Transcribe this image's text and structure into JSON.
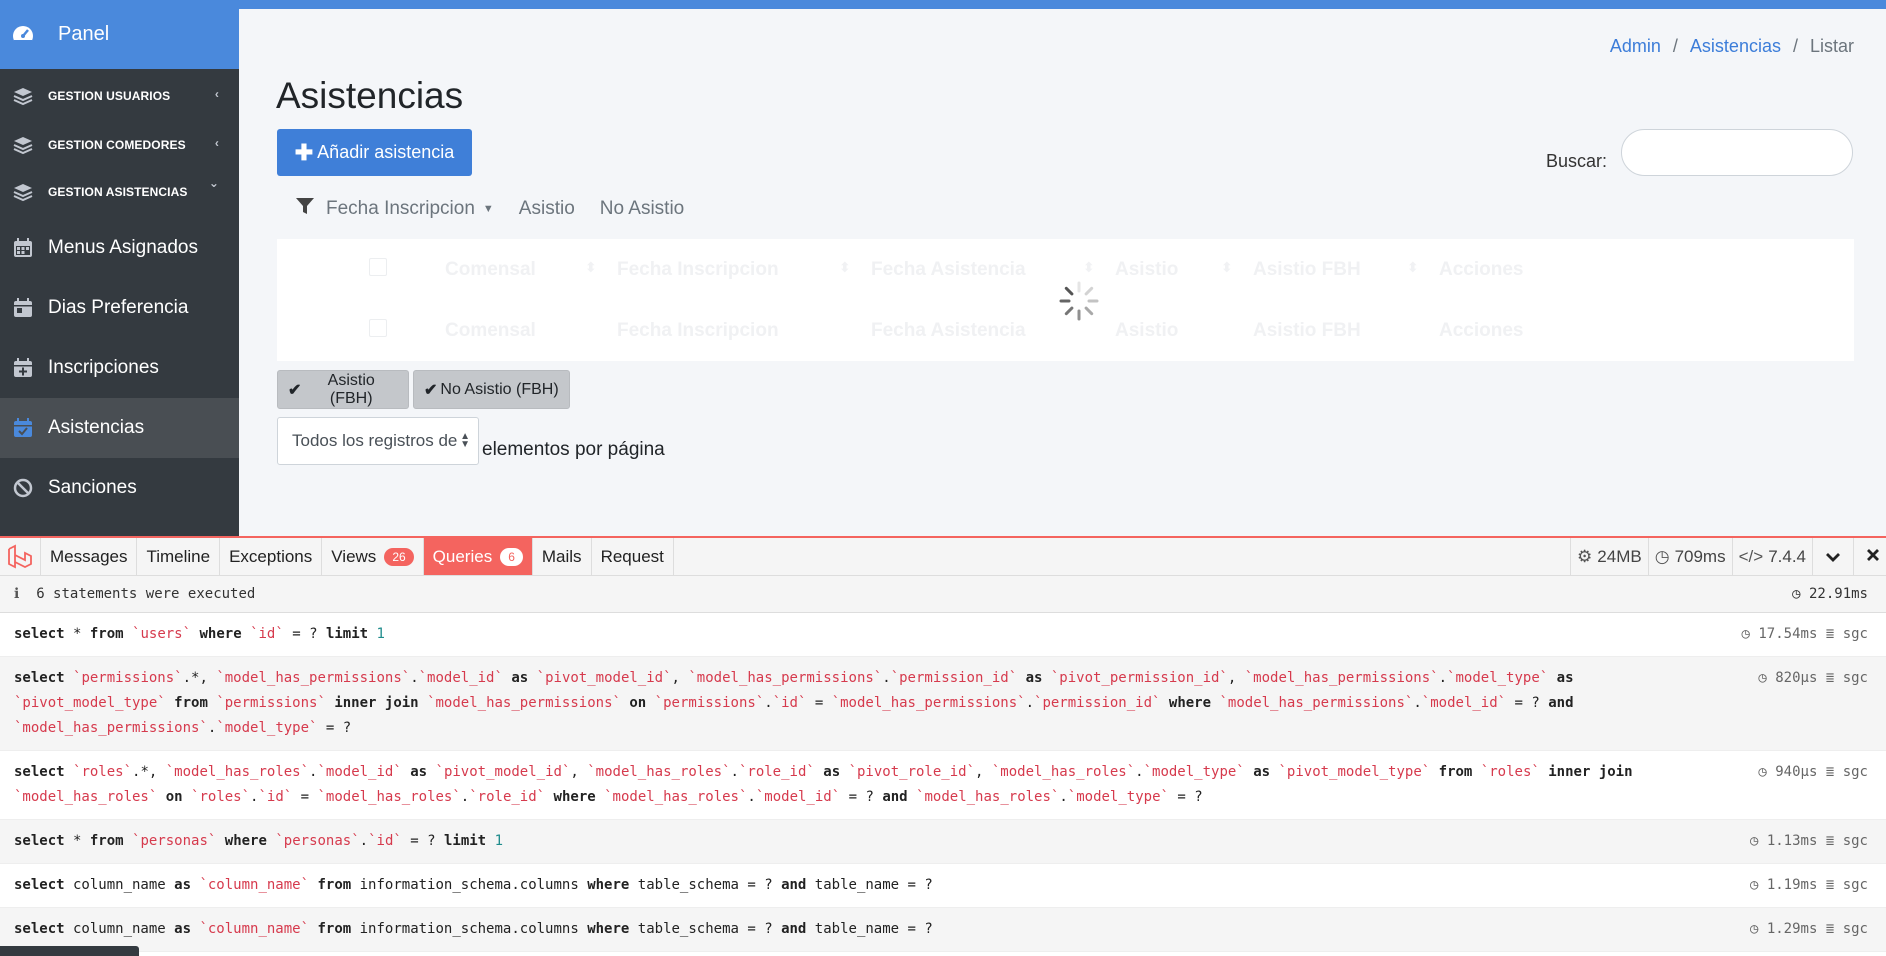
{
  "sidebar": {
    "brand": "Panel",
    "groups": [
      {
        "label": "GESTION USUARIOS",
        "chevron": "‹"
      },
      {
        "label": "GESTION COMEDORES",
        "chevron": "‹"
      },
      {
        "label": "GESTION ASISTENCIAS",
        "chevron": "⌄"
      }
    ],
    "links": [
      {
        "label": "Menus Asignados",
        "icon": "calendar-icon"
      },
      {
        "label": "Dias Preferencia",
        "icon": "calendar-day-icon"
      },
      {
        "label": "Inscripciones",
        "icon": "calendar-plus-icon"
      },
      {
        "label": "Asistencias",
        "icon": "calendar-check-icon",
        "active": true
      },
      {
        "label": "Sanciones",
        "icon": "ban-icon"
      }
    ]
  },
  "breadcrumb": {
    "admin": "Admin",
    "sep": "/",
    "section": "Asistencias",
    "current": "Listar"
  },
  "page": {
    "title": "Asistencias",
    "add_button": "Añadir asistencia",
    "search_label": "Buscar:",
    "filters": {
      "date": "Fecha Inscripcion",
      "yes": "Asistio",
      "no": "No Asistio"
    },
    "columns": [
      "Comensal",
      "Fecha Inscripcion",
      "Fecha Asistencia",
      "Asistio",
      "Asistio FBH",
      "Acciones"
    ],
    "bulk_yes": "Asistio (FBH)",
    "bulk_no": "No Asistio (FBH)",
    "page_size_value": "Todos los registros de",
    "page_size_label": "elementos por página"
  },
  "debugbar": {
    "tabs": [
      {
        "label": "Messages"
      },
      {
        "label": "Timeline"
      },
      {
        "label": "Exceptions"
      },
      {
        "label": "Views",
        "badge": "26"
      },
      {
        "label": "Queries",
        "badge": "6",
        "active": true
      },
      {
        "label": "Mails"
      },
      {
        "label": "Request"
      }
    ],
    "memory": "24MB",
    "time": "709ms",
    "php": "7.4.4",
    "status_text": "6 statements were executed",
    "total_time": "22.91ms",
    "queries": [
      {
        "time": "17.54ms",
        "conn": "sgc"
      },
      {
        "time": "820μs",
        "conn": "sgc"
      },
      {
        "time": "940μs",
        "conn": "sgc"
      },
      {
        "time": "1.13ms",
        "conn": "sgc"
      },
      {
        "time": "1.19ms",
        "conn": "sgc"
      },
      {
        "time": "1.29ms",
        "conn": "sgc"
      }
    ]
  },
  "colors": {
    "brand": "#4a89dc",
    "sidebar": "#343a40",
    "debug_accent": "#f4645f"
  }
}
